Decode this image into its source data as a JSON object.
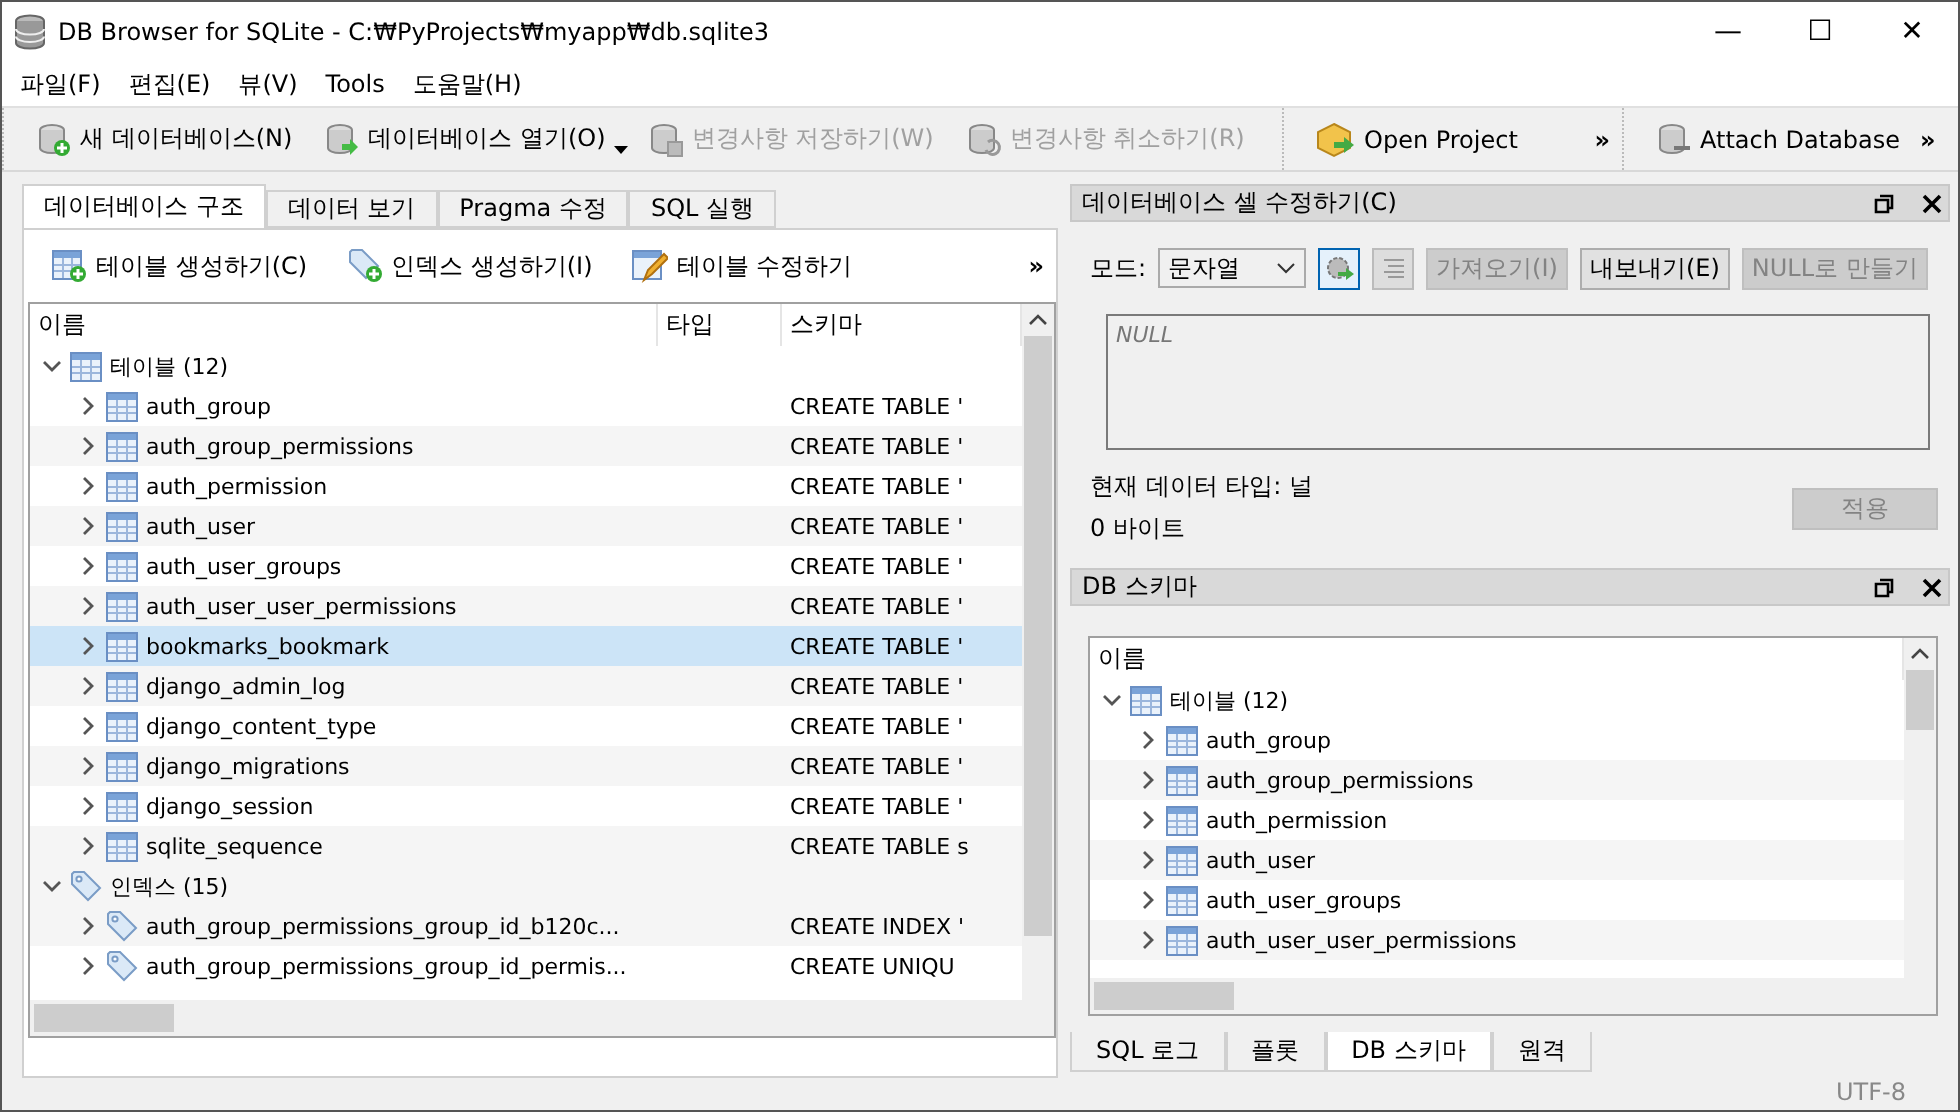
{
  "window": {
    "title": "DB Browser for SQLite - C:₩PyProjects₩myapp₩db.sqlite3",
    "controls": [
      "—",
      "☐",
      "✕"
    ]
  },
  "menu": [
    "파일(F)",
    "편집(E)",
    "뷰(V)",
    "Tools",
    "도움말(H)"
  ],
  "toolbars": [
    {
      "items": [
        {
          "label": "새 데이터베이스(N)",
          "kind": "new",
          "disabled": false
        },
        {
          "label": "데이터베이스 열기(O)",
          "kind": "open",
          "disabled": false,
          "dropdown": true
        },
        {
          "label": "변경사항 저장하기(W)",
          "kind": "save",
          "disabled": true
        },
        {
          "label": "변경사항 취소하기(R)",
          "kind": "revert",
          "disabled": true
        }
      ]
    },
    {
      "items": [
        {
          "label": "Open Project",
          "kind": "project",
          "disabled": false
        }
      ],
      "overflow": "»"
    },
    {
      "items": [
        {
          "label": "Attach Database",
          "kind": "attach",
          "disabled": false
        }
      ],
      "overflow": "»"
    }
  ],
  "left": {
    "tabs": [
      {
        "label": "데이터베이스 구조",
        "selected": true
      },
      {
        "label": "데이터 보기",
        "selected": false
      },
      {
        "label": "Pragma 수정",
        "selected": false
      },
      {
        "label": "SQL 실행",
        "selected": false
      }
    ],
    "actions": [
      {
        "label": "테이블 생성하기(C)",
        "kind": "create"
      },
      {
        "label": "인덱스 생성하기(I)",
        "kind": "index"
      },
      {
        "label": "테이블 수정하기",
        "kind": "edit"
      }
    ],
    "actions_overflow": "»",
    "tree": {
      "columns": [
        "이름",
        "타입",
        "스키마"
      ],
      "groups": [
        {
          "label": "테이블 (12)",
          "kind": "table",
          "expanded": true,
          "children": [
            {
              "name": "auth_group",
              "schema": "CREATE TABLE '",
              "selected": false
            },
            {
              "name": "auth_group_permissions",
              "schema": "CREATE TABLE '",
              "selected": false
            },
            {
              "name": "auth_permission",
              "schema": "CREATE TABLE '",
              "selected": false
            },
            {
              "name": "auth_user",
              "schema": "CREATE TABLE '",
              "selected": false
            },
            {
              "name": "auth_user_groups",
              "schema": "CREATE TABLE '",
              "selected": false
            },
            {
              "name": "auth_user_user_permissions",
              "schema": "CREATE TABLE '",
              "selected": false
            },
            {
              "name": "bookmarks_bookmark",
              "schema": "CREATE TABLE '",
              "selected": true
            },
            {
              "name": "django_admin_log",
              "schema": "CREATE TABLE '",
              "selected": false
            },
            {
              "name": "django_content_type",
              "schema": "CREATE TABLE '",
              "selected": false
            },
            {
              "name": "django_migrations",
              "schema": "CREATE TABLE '",
              "selected": false
            },
            {
              "name": "django_session",
              "schema": "CREATE TABLE '",
              "selected": false
            },
            {
              "name": "sqlite_sequence",
              "schema": "CREATE TABLE s",
              "selected": false
            }
          ]
        },
        {
          "label": "인덱스 (15)",
          "kind": "index",
          "expanded": true,
          "children": [
            {
              "name": "auth_group_permissions_group_id_b120c...",
              "schema": "CREATE INDEX '",
              "selected": false
            },
            {
              "name": "auth_group_permissions_group_id_permis...",
              "schema": "CREATE UNIQU",
              "selected": false
            }
          ]
        }
      ]
    }
  },
  "edit_cell": {
    "title": "데이터베이스 셀 수정하기(C)",
    "mode_label": "모드:",
    "mode": "문자열",
    "buttons": [
      {
        "label": "가져오기(I)",
        "disabled": true
      },
      {
        "label": "내보내기(E)",
        "disabled": false
      },
      {
        "label": "NULL로 만들기",
        "disabled": true
      }
    ],
    "placeholder": "NULL",
    "data_type": "현재 데이터 타입: 널",
    "size": "0 바이트",
    "apply": {
      "label": "적용",
      "disabled": true
    }
  },
  "schema_dock": {
    "title": "DB 스키마",
    "columns": [
      "이름"
    ],
    "groups": [
      {
        "label": "테이블 (12)",
        "kind": "table",
        "expanded": true,
        "children": [
          {
            "name": "auth_group",
            "selected": false
          },
          {
            "name": "auth_group_permissions",
            "selected": false
          },
          {
            "name": "auth_permission",
            "selected": false
          },
          {
            "name": "auth_user",
            "selected": false
          },
          {
            "name": "auth_user_groups",
            "selected": false
          },
          {
            "name": "auth_user_user_permissions",
            "selected": false
          }
        ]
      }
    ]
  },
  "bottom_tabs": [
    {
      "label": "SQL 로그",
      "selected": false
    },
    {
      "label": "플롯",
      "selected": false
    },
    {
      "label": "DB 스키마",
      "selected": true
    },
    {
      "label": "원격",
      "selected": false
    }
  ],
  "status_bar": {
    "encoding": "UTF-8"
  }
}
